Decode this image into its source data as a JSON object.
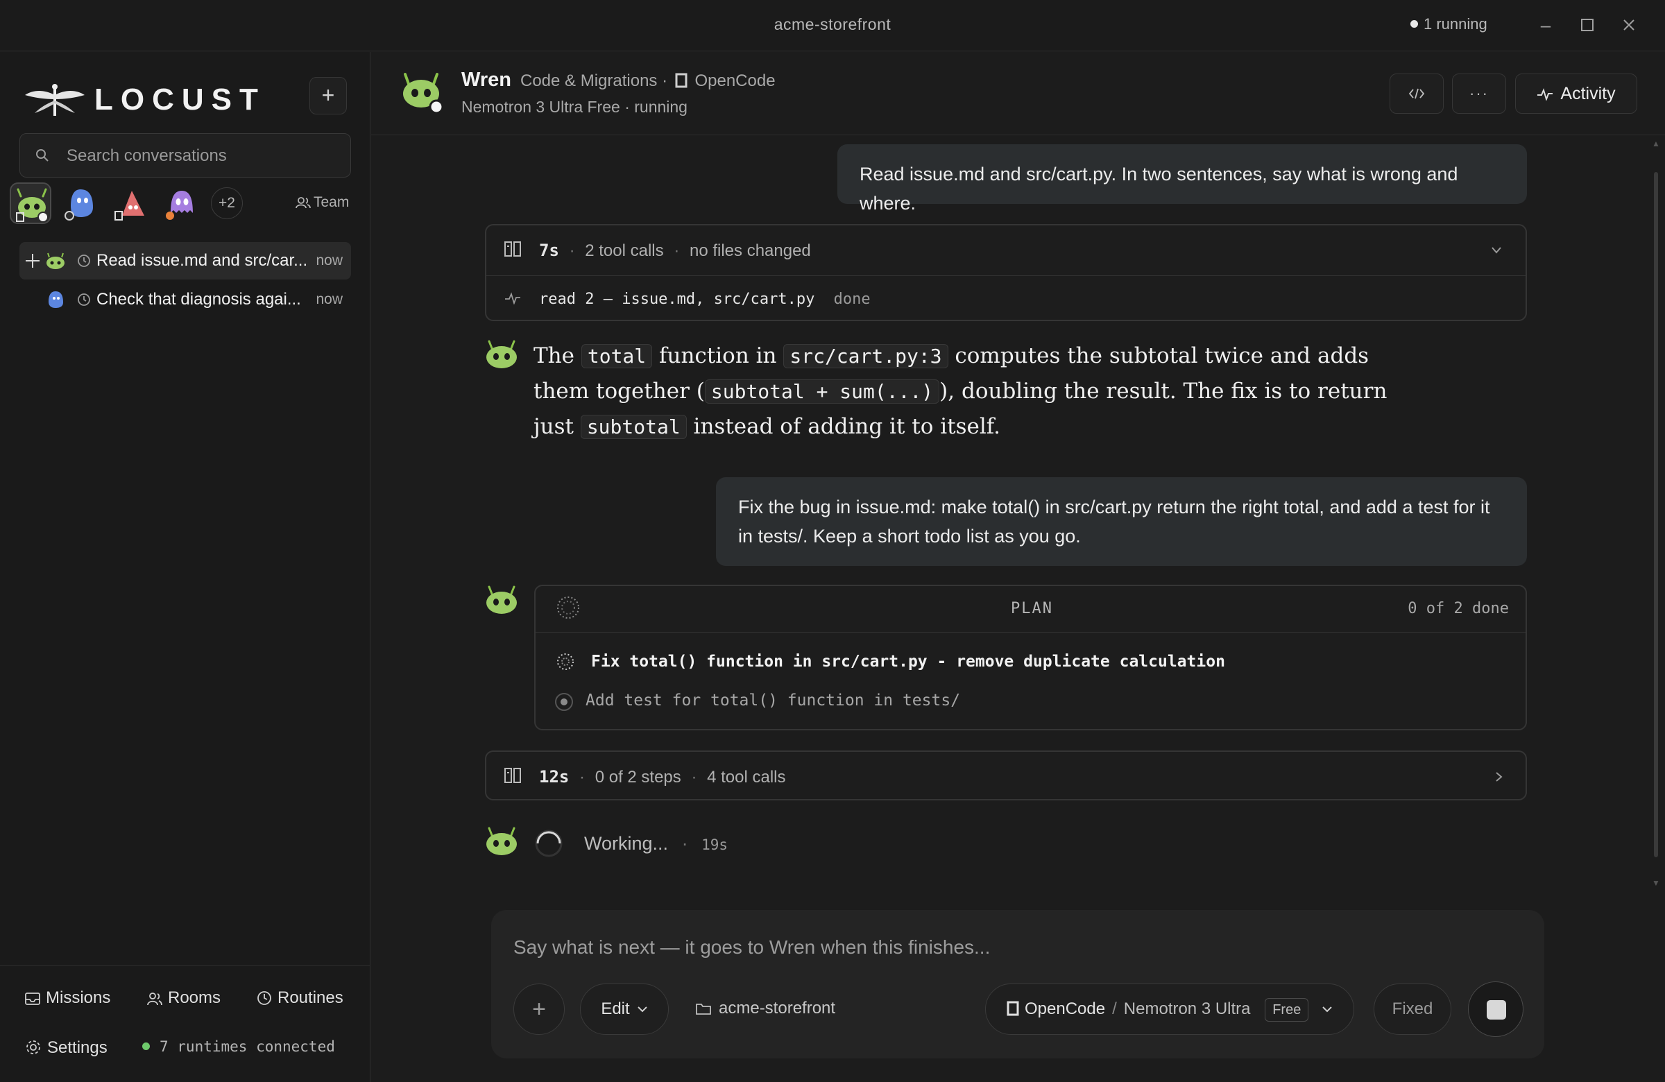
{
  "window": {
    "title": "acme-storefront",
    "running": "1 running"
  },
  "sidebar": {
    "logo_text": "LOCUST",
    "search_placeholder": "Search conversations",
    "more_agents": "+2",
    "team_label": "Team",
    "conversations": [
      {
        "label": "Read issue.md and src/car...",
        "time": "now"
      },
      {
        "label": "Check that diagnosis agai...",
        "time": "now"
      }
    ],
    "footer": {
      "missions": "Missions",
      "rooms": "Rooms",
      "routines": "Routines",
      "settings": "Settings",
      "runtimes": "7 runtimes connected"
    }
  },
  "header": {
    "agent_name": "Wren",
    "category": "Code & Migrations",
    "separator": "·",
    "runtime": "OpenCode",
    "model_status": "Nemotron 3 Ultra Free · running",
    "activity_label": "Activity"
  },
  "chat": {
    "user_msg_1": "Read issue.md and src/cart.py. In two sentences, say what is wrong and where.",
    "tool_summary_1": {
      "duration": "7s",
      "calls": "2 tool calls",
      "changes": "no files changed",
      "detail": "read 2 — issue.md, src/cart.py",
      "status": "done"
    },
    "ai_msg": {
      "t1": "The",
      "c1": "total",
      "t2": "function in",
      "c2": "src/cart.py:3",
      "t3": "computes the subtotal twice and adds them together (",
      "c3": "subtotal + sum(...)",
      "t4": "), doubling the result. The fix is to return just",
      "c4": "subtotal",
      "t5": "instead of adding it to itself."
    },
    "user_msg_2": "Fix the bug in issue.md: make total() in src/cart.py return the right total, and add a test for it in tests/. Keep a short todo list as you go.",
    "plan": {
      "title": "PLAN",
      "progress": "0 of 2 done",
      "items": [
        {
          "text": "Fix total() function in src/cart.py - remove duplicate calculation",
          "state": "in-progress"
        },
        {
          "text": "Add test for total() function in tests/",
          "state": "pending"
        }
      ]
    },
    "tool_summary_2": {
      "duration": "12s",
      "steps": "0 of 2 steps",
      "calls": "4 tool calls"
    },
    "working": {
      "label": "Working...",
      "elapsed": "19s"
    }
  },
  "composer": {
    "placeholder": "Say what is next — it goes to Wren when this finishes...",
    "mode": "Edit",
    "folder": "acme-storefront",
    "runtime": "OpenCode",
    "model": "Nemotron 3 Ultra",
    "badge": "Free",
    "fixed": "Fixed"
  }
}
